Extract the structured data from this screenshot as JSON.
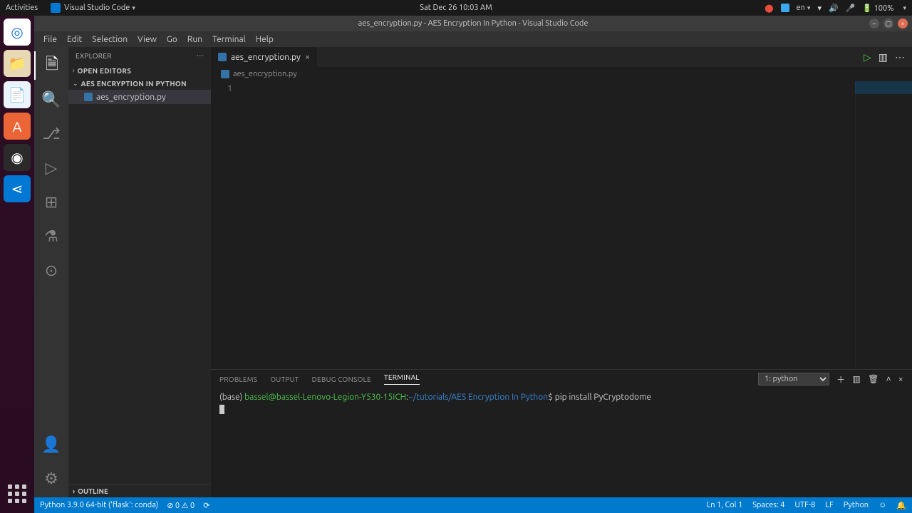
{
  "topbar": {
    "activities": "Activities",
    "app": "Visual Studio Code",
    "clock": "Sat Dec 26  10:03 AM",
    "lang": "en",
    "battery": "100%"
  },
  "title": "aes_encryption.py - AES Encryption In Python - Visual Studio Code",
  "menu": [
    "File",
    "Edit",
    "Selection",
    "View",
    "Go",
    "Run",
    "Terminal",
    "Help"
  ],
  "sidebar": {
    "title": "EXPLORER",
    "openEditors": "OPEN EDITORS",
    "folder": "AES ENCRYPTION IN PYTHON",
    "file": "aes_encryption.py",
    "outline": "OUTLINE"
  },
  "tab": {
    "name": "aes_encryption.py"
  },
  "breadcrumb": {
    "file": "aes_encryption.py"
  },
  "editor": {
    "line1": "1"
  },
  "panel": {
    "problems": "PROBLEMS",
    "output": "OUTPUT",
    "debugconsole": "DEBUG CONSOLE",
    "terminal": "TERMINAL",
    "shell": "1: python",
    "prompt_base": "(base) ",
    "prompt_user": "bassel@bassel-Lenovo-Legion-Y530-15ICH",
    "prompt_colon": ":",
    "prompt_path": "~/tutorials/AES Encryption In Python",
    "prompt_dollar": "$ ",
    "command": "pip install PyCryptodome"
  },
  "status": {
    "py": "Python 3.9.0 64-bit ('flask': conda)",
    "errs": "⊘ 0 ⚠ 0",
    "rad": "⟳",
    "pos": "Ln 1, Col 1",
    "spaces": "Spaces: 4",
    "enc": "UTF-8",
    "eol": "LF",
    "lang": "Python",
    "feedback": "☺",
    "bell": "🔔"
  }
}
